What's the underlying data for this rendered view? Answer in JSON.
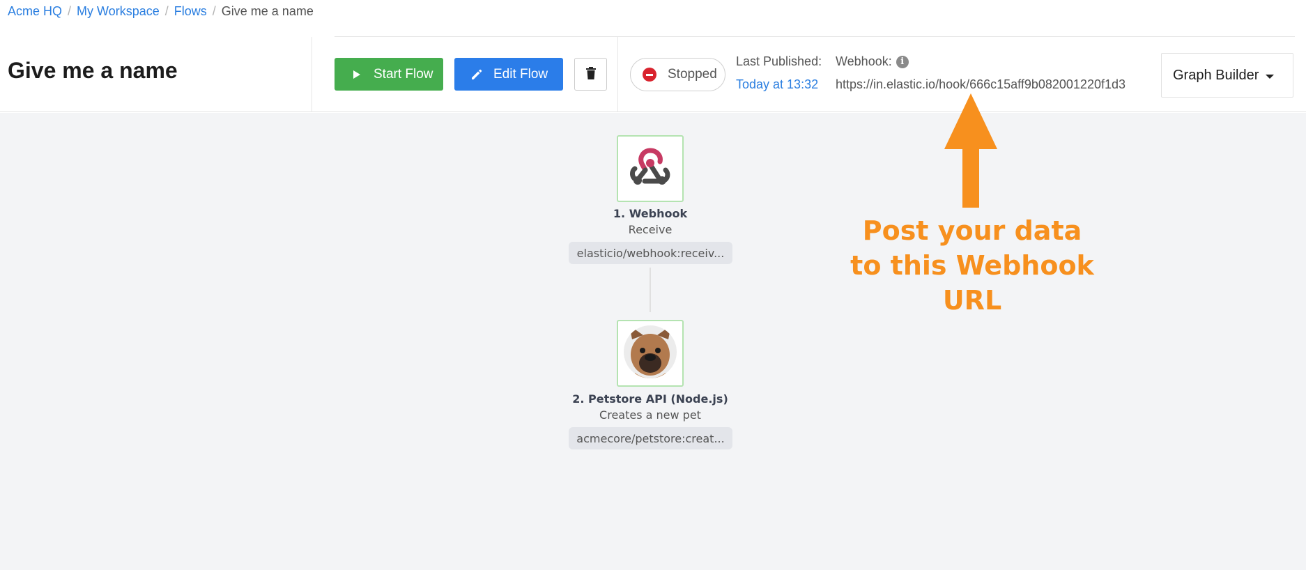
{
  "breadcrumb": {
    "items": [
      "Acme HQ",
      "My Workspace",
      "Flows"
    ],
    "current": "Give me a name",
    "separator": "/"
  },
  "flow": {
    "title": "Give me a name",
    "start_label": "Start Flow",
    "edit_label": "Edit Flow",
    "status": "Stopped",
    "last_published_label": "Last Published:",
    "last_published_value": "Today at 13:32",
    "webhook_label": "Webhook:",
    "webhook_url": "https://in.elastic.io/hook/666c15aff9b082001220f1d3",
    "view_mode": "Graph Builder"
  },
  "nodes": [
    {
      "title": "1. Webhook",
      "subtitle": "Receive",
      "tag": "elasticio/webhook:receiv...",
      "icon": "webhook-icon"
    },
    {
      "title": "2. Petstore API (Node.js)",
      "subtitle": "Creates a new pet",
      "tag": "acmecore/petstore:creat...",
      "icon": "dog-avatar-icon"
    }
  ],
  "annotation": {
    "line1": "Post your data",
    "line2": "to this Webhook URL"
  },
  "colors": {
    "link": "#2a7ee0",
    "start_button": "#45ad4e",
    "edit_button": "#2b7de9",
    "stopped": "#d9232e",
    "annotation": "#f7901e",
    "canvas": "#f3f4f6",
    "node_border": "#b4e3b1"
  }
}
